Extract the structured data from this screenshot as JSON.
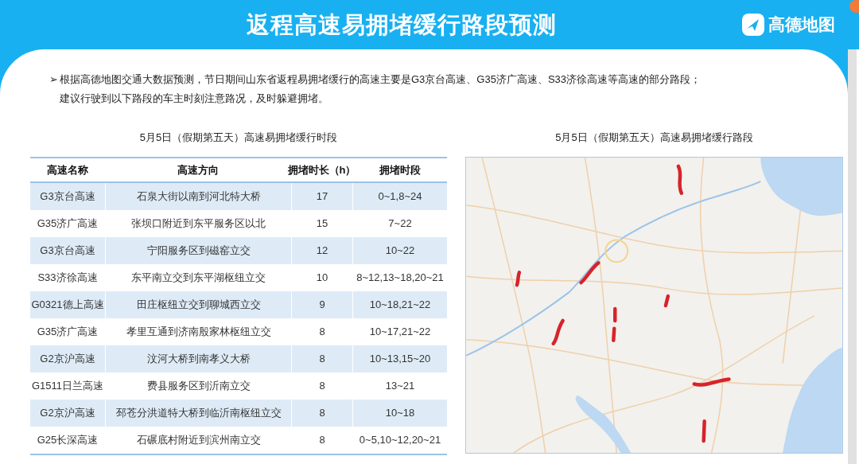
{
  "header": {
    "title": "返程高速易拥堵缓行路段预测",
    "logo_text": "高德地图"
  },
  "intro": {
    "bullet": "➢",
    "lines": [
      "根据高德地图交通大数据预测，节日期间山东省返程易拥堵缓行的高速主要是G3京台高速、G35济广高速、S33济徐高速等高速的部分路段；",
      "建议行驶到以下路段的车主时刻注意路况，及时躲避拥堵。"
    ]
  },
  "table_section": {
    "title": "5月5日（假期第五天）高速易拥堵缓行时段",
    "columns": [
      "高速名称",
      "高速方向",
      "拥堵时长（h）",
      "拥堵时段"
    ],
    "rows": [
      {
        "name": "G3京台高速",
        "direction": "石泉大街以南到河北特大桥",
        "duration": "17",
        "period": "0~1,8~24"
      },
      {
        "name": "G35济广高速",
        "direction": "张坝口附近到东平服务区以北",
        "duration": "15",
        "period": "7~22"
      },
      {
        "name": "G3京台高速",
        "direction": "宁阳服务区到磁窑立交",
        "duration": "12",
        "period": "10~22"
      },
      {
        "name": "S33济徐高速",
        "direction": "东平南立交到东平湖枢纽立交",
        "duration": "10",
        "period": "8~12,13~18,20~21"
      },
      {
        "name": "G0321德上高速",
        "direction": "田庄枢纽立交到聊城西立交",
        "duration": "9",
        "period": "10~18,21~22"
      },
      {
        "name": "G35济广高速",
        "direction": "孝里互通到济南殷家林枢纽立交",
        "duration": "8",
        "period": "10~17,21~22"
      },
      {
        "name": "G2京沪高速",
        "direction": "汶河大桥到南孝义大桥",
        "duration": "8",
        "period": "10~13,15~20"
      },
      {
        "name": "G1511日兰高速",
        "direction": "费县服务区到沂南立交",
        "duration": "8",
        "period": "13~21"
      },
      {
        "name": "G2京沪高速",
        "direction": "邳苍分洪道特大桥到临沂南枢纽立交",
        "duration": "8",
        "period": "10~18"
      },
      {
        "name": "G25长深高速",
        "direction": "石碾底村附近到滨州南立交",
        "duration": "8",
        "period": "0~5,10~12,20~21"
      }
    ]
  },
  "map_section": {
    "title": "5月5日（假期第五天）高速易拥堵缓行路段"
  }
}
